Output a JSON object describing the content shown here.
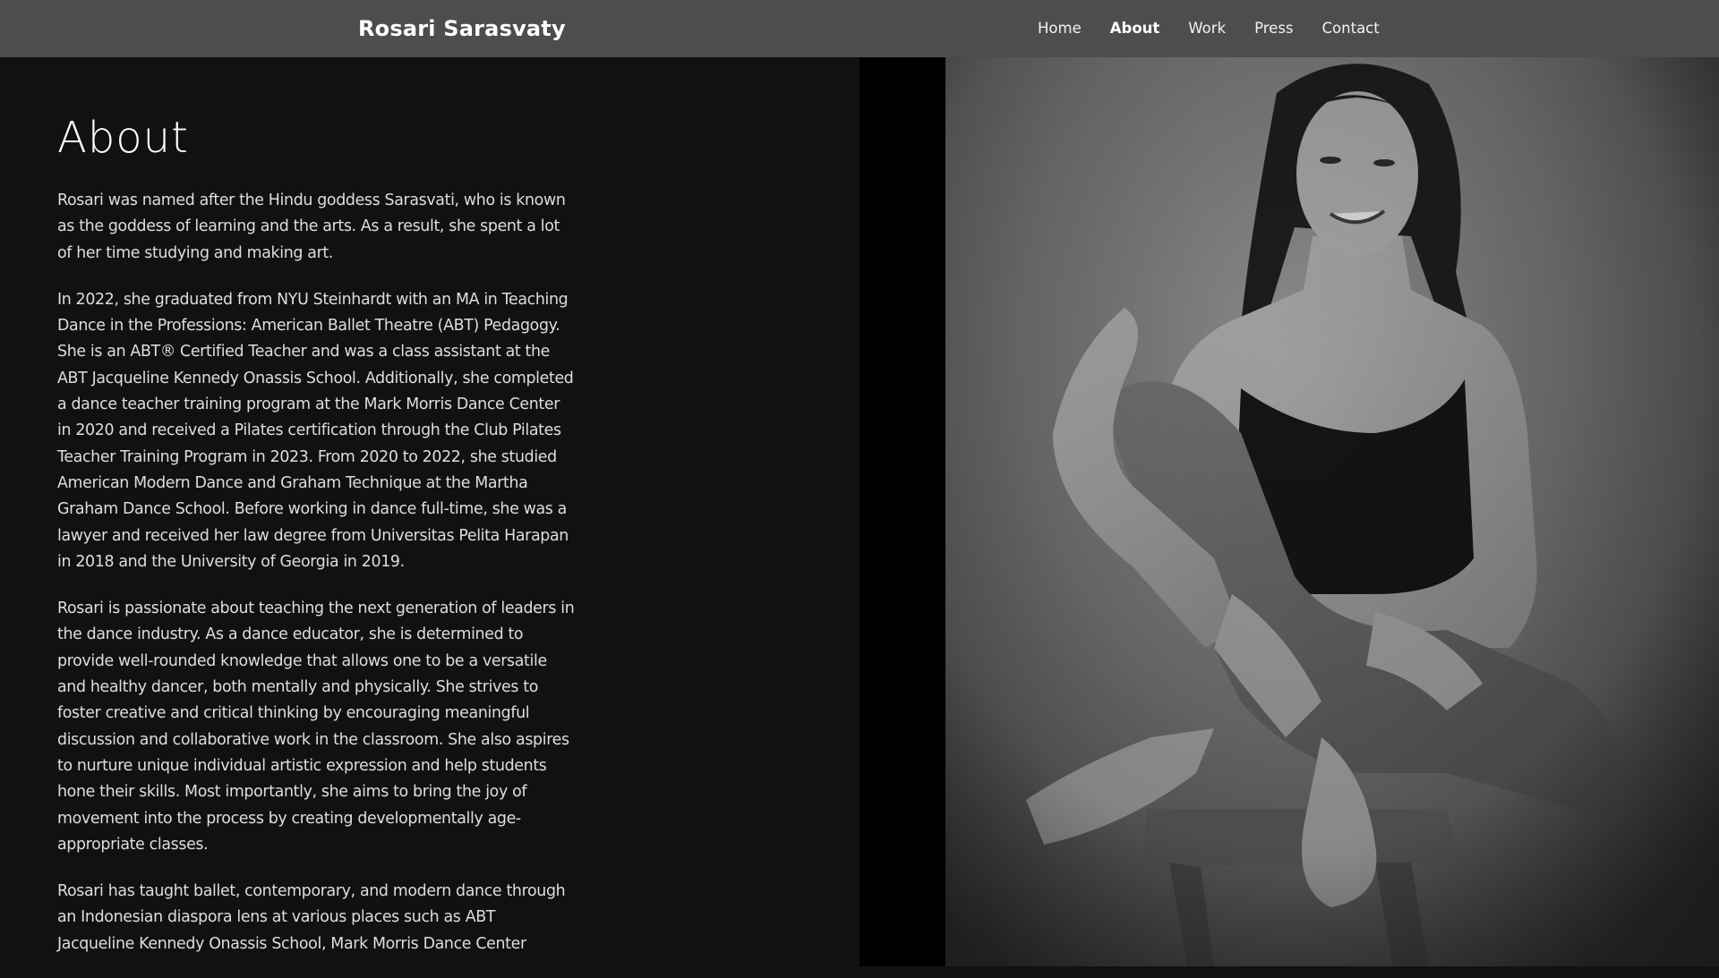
{
  "nav": {
    "brand": "Rosari Sarasvaty",
    "links": [
      {
        "label": "Home",
        "active": false
      },
      {
        "label": "About",
        "active": true
      },
      {
        "label": "Work",
        "active": false
      },
      {
        "label": "Press",
        "active": false
      },
      {
        "label": "Contact",
        "active": false
      }
    ]
  },
  "about": {
    "title": "About",
    "paragraphs": [
      "Rosari was named after the Hindu goddess Sarasvati, who is known as the goddess of learning and the arts. As a result, she spent a lot of her time studying and making art.",
      "In 2022, she graduated from NYU Steinhardt with an MA in Teaching Dance in the Professions: American Ballet Theatre (ABT) Pedagogy. She is an ABT® Certified Teacher and was a class assistant at the ABT Jacqueline Kennedy Onassis School. Additionally, she completed a dance teacher training program at the Mark Morris Dance Center in 2020 and received a Pilates certification through the Club Pilates Teacher Training Program in 2023. From 2020 to 2022, she studied American Modern Dance and Graham Technique at the Martha Graham Dance School. Before working in dance full-time, she was a lawyer and received her law degree from Universitas Pelita Harapan in 2018 and the University of Georgia in 2019.",
      "Rosari is passionate about teaching the next generation of leaders in the dance industry. As a dance educator, she is determined to provide well-rounded knowledge that allows one to be a versatile and healthy dancer, both mentally and physically. She strives to foster creative and critical thinking by encouraging meaningful discussion and collaborative work in the classroom. She also aspires to nurture unique individual artistic expression and help students hone their skills. Most importantly, she aims to bring the joy of movement into the process by creating developmentally age-appropriate classes.",
      "Rosari has taught ballet, contemporary, and modern dance through an Indonesian diaspora lens at various places such as ABT Jacqueline Kennedy Onassis School, Mark Morris Dance Center"
    ]
  },
  "colors": {
    "nav_bg": "#4d4d4d",
    "page_bg": "#111112",
    "text": "#dedede"
  }
}
